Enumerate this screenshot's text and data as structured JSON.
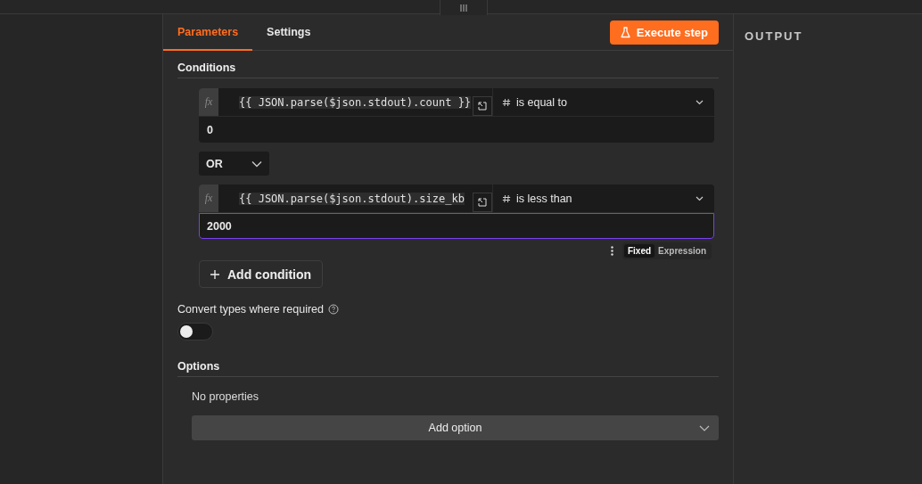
{
  "tabs": [
    {
      "label": "Parameters",
      "selected": true
    },
    {
      "label": "Settings",
      "selected": false
    }
  ],
  "execute_button": {
    "label": "Execute step"
  },
  "conditions": {
    "title": "Conditions",
    "rows": [
      {
        "mode_badge": "fx",
        "expression": "{{ JSON.parse($json.stdout).count }}",
        "operator": "is equal to",
        "value": "0",
        "focused": false
      },
      {
        "mode_badge": "fx",
        "expression": "{{ JSON.parse($json.stdout).size_kb",
        "operator": "is less than",
        "value": "2000",
        "focused": true
      }
    ],
    "combinator": "OR",
    "mode_options": [
      {
        "label": "Fixed",
        "selected": true
      },
      {
        "label": "Expression",
        "selected": false
      }
    ],
    "add_button": "Add condition"
  },
  "convert_types": {
    "label": "Convert types where required",
    "on": false
  },
  "options": {
    "title": "Options",
    "empty_text": "No properties",
    "add_button": "Add option"
  },
  "output_panel": {
    "title": "OUTPUT"
  }
}
